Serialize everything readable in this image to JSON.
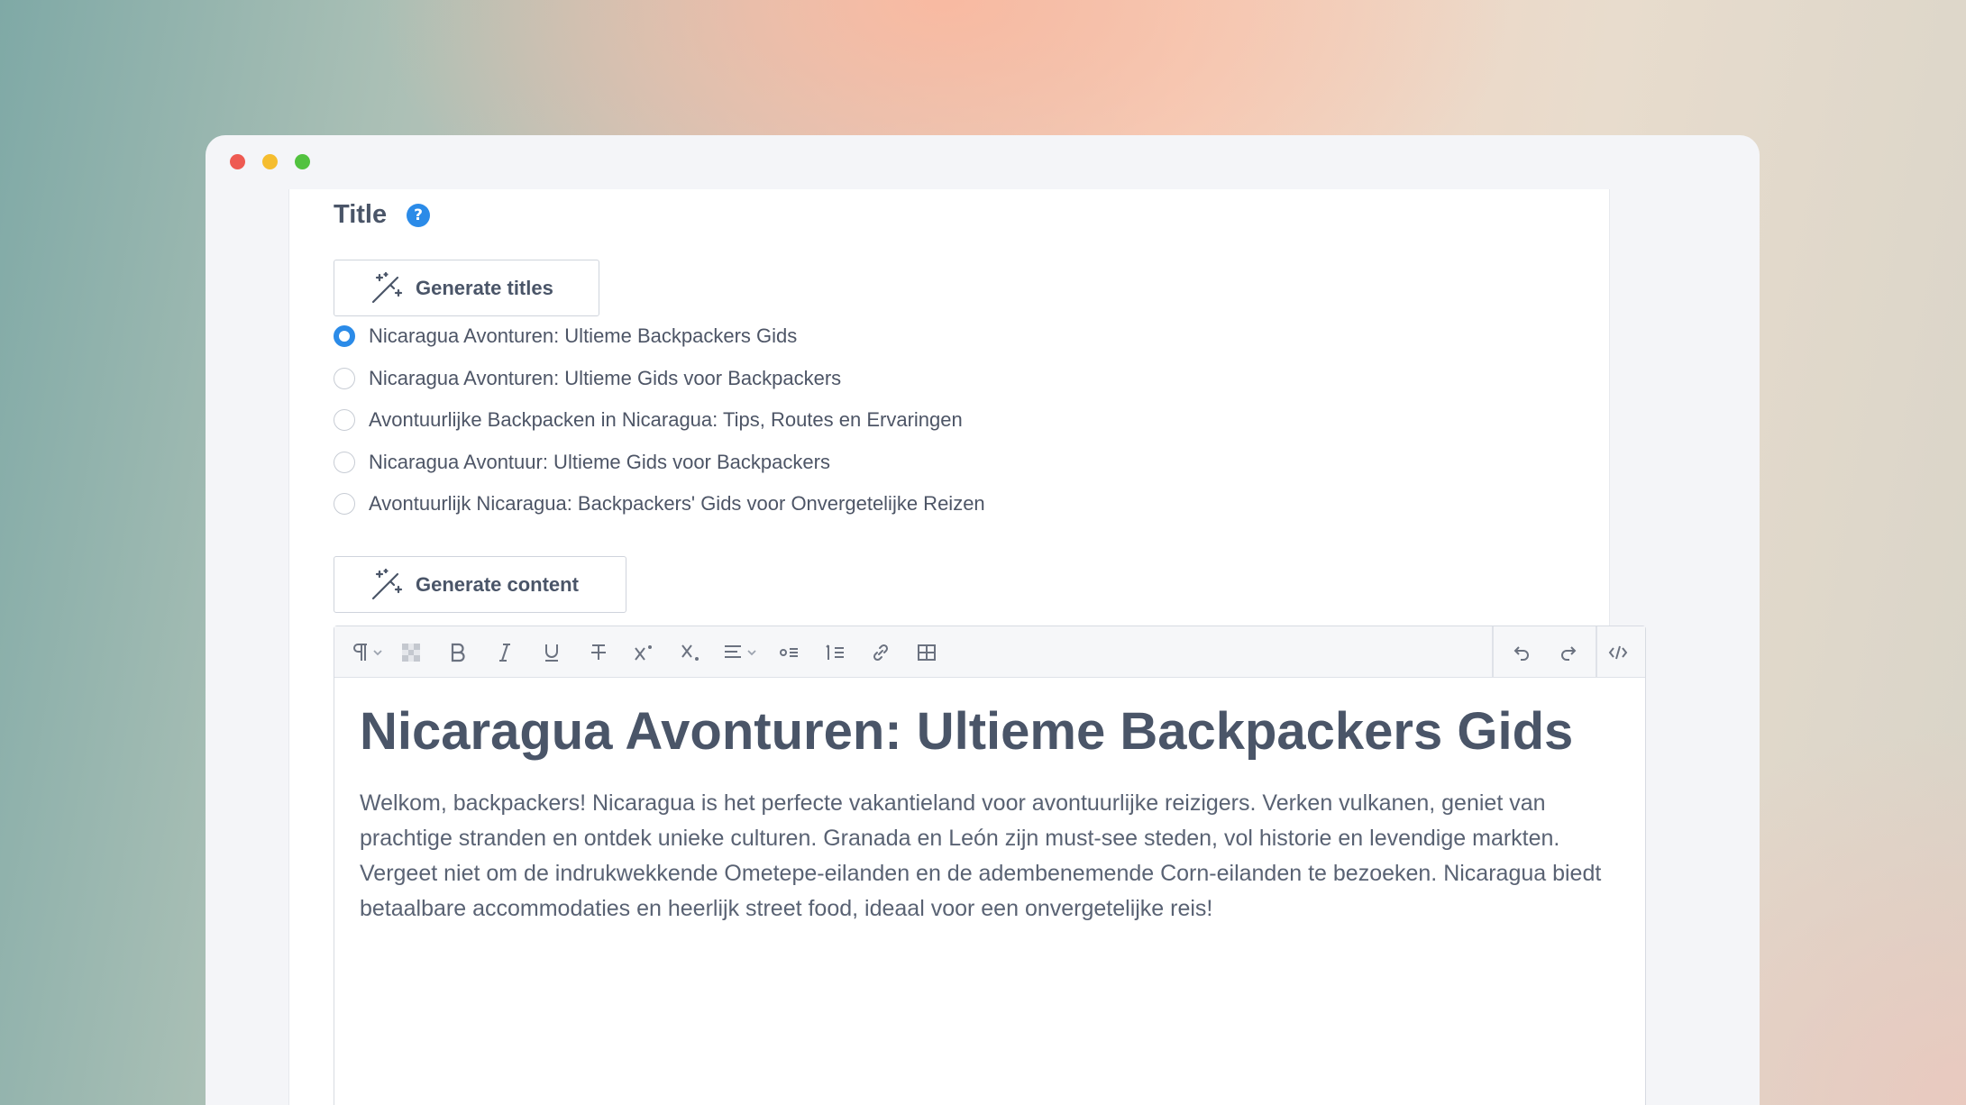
{
  "section": {
    "title": "Title",
    "help_icon": "?"
  },
  "buttons": {
    "generate_titles": "Generate titles",
    "generate_content": "Generate content"
  },
  "title_options": [
    {
      "label": "Nicaragua Avonturen: Ultieme Backpackers Gids",
      "selected": true
    },
    {
      "label": "Nicaragua Avonturen: Ultieme Gids voor Backpackers",
      "selected": false
    },
    {
      "label": "Avontuurlijke Backpacken in Nicaragua: Tips, Routes en Ervaringen",
      "selected": false
    },
    {
      "label": "Nicaragua Avontuur: Ultieme Gids voor Backpackers",
      "selected": false
    },
    {
      "label": "Avontuurlijk Nicaragua: Backpackers' Gids voor Onvergetelijke Reizen",
      "selected": false
    }
  ],
  "editor": {
    "heading": "Nicaragua Avonturen: Ultieme Backpackers Gids",
    "body": "Welkom, backpackers! Nicaragua is het perfecte vakantieland voor avontuurlijke reizigers. Verken vulkanen, geniet van prachtige stranden en ontdek unieke culturen. Granada en León zijn must-see steden, vol historie en levendige markten. Vergeet niet om de indrukwekkende Ometepe-eilanden en de adembenemende Corn-eilanden te bezoeken. Nicaragua biedt betaalbare accommodaties en heerlijk street food, ideaal voor een onvergetelijke reis!"
  },
  "toolbar_icons": [
    "paragraph-icon",
    "clear-format-icon",
    "bold-icon",
    "italic-icon",
    "underline-icon",
    "strikethrough-icon",
    "superscript-icon",
    "subscript-icon",
    "align-icon",
    "bullet-list-icon",
    "numbered-list-icon",
    "link-icon",
    "table-icon",
    "undo-icon",
    "redo-icon",
    "code-view-icon"
  ],
  "colors": {
    "accent": "#2b8be8",
    "text": "#4a5568"
  }
}
